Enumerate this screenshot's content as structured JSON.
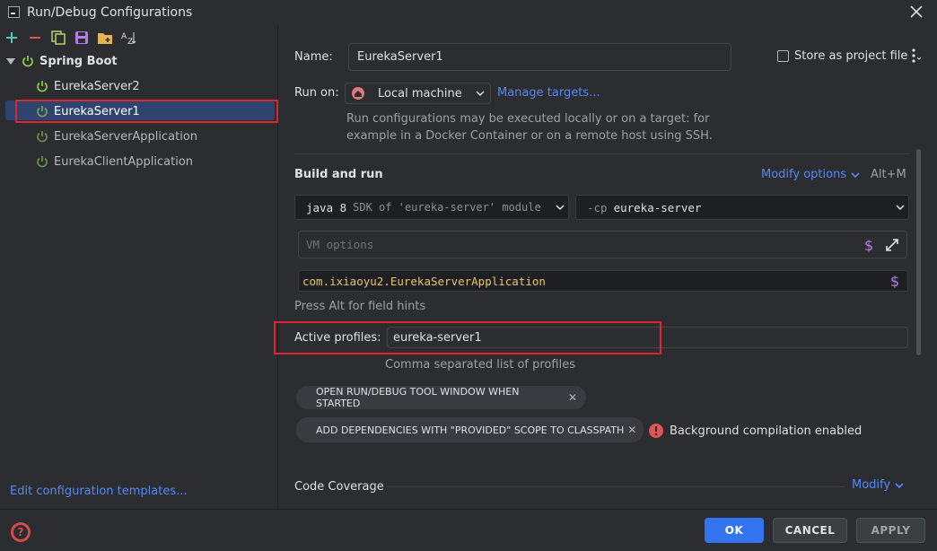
{
  "window": {
    "title": "Run/Debug Configurations"
  },
  "tree": {
    "group": "Spring Boot",
    "items": [
      {
        "label": "EurekaServer2",
        "active": true
      },
      {
        "label": "EurekaServer1",
        "selected": true
      },
      {
        "label": "EurekaServerApplication",
        "active": false
      },
      {
        "label": "EurekaClientApplication",
        "active": false
      }
    ],
    "edit_templates": "Edit configuration templates..."
  },
  "form": {
    "name_label": "Name:",
    "name_value": "EurekaServer1",
    "store_label": "Store as project file",
    "run_on_label": "Run on:",
    "run_on_value": "Local machine",
    "manage_targets": "Manage targets...",
    "run_on_hint_1": "Run configurations may be executed locally or on a target: for",
    "run_on_hint_2": "example in a Docker Container or on a remote host using SSH.",
    "build_run_title": "Build and run",
    "modify_options": "Modify options",
    "modify_shortcut": "Alt+M",
    "sdk_main": "java 8",
    "sdk_detail": "SDK of 'eureka-server' module",
    "cp_prefix": "-cp",
    "cp_value": "eureka-server",
    "vm_placeholder": "VM options",
    "main_class": "com.ixiaoyu2.EurekaServerApplication",
    "field_hint": "Press Alt for field hints",
    "profiles_label": "Active profiles:",
    "profiles_value": "eureka-server1",
    "profiles_hint": "Comma separated list of profiles",
    "chip_1": "OPEN RUN/DEBUG TOOL WINDOW WHEN STARTED",
    "chip_2": "ADD DEPENDENCIES WITH \"PROVIDED\" SCOPE TO CLASSPATH",
    "bg_compile": "Background compilation enabled",
    "code_coverage": "Code Coverage",
    "modify": "Modify"
  },
  "buttons": {
    "ok": "OK",
    "cancel": "CANCEL",
    "apply": "APPLY"
  },
  "colors": {
    "accent": "#3574f0",
    "link": "#548af7",
    "spring": "#7cb342",
    "highlight": "#e0242e"
  }
}
